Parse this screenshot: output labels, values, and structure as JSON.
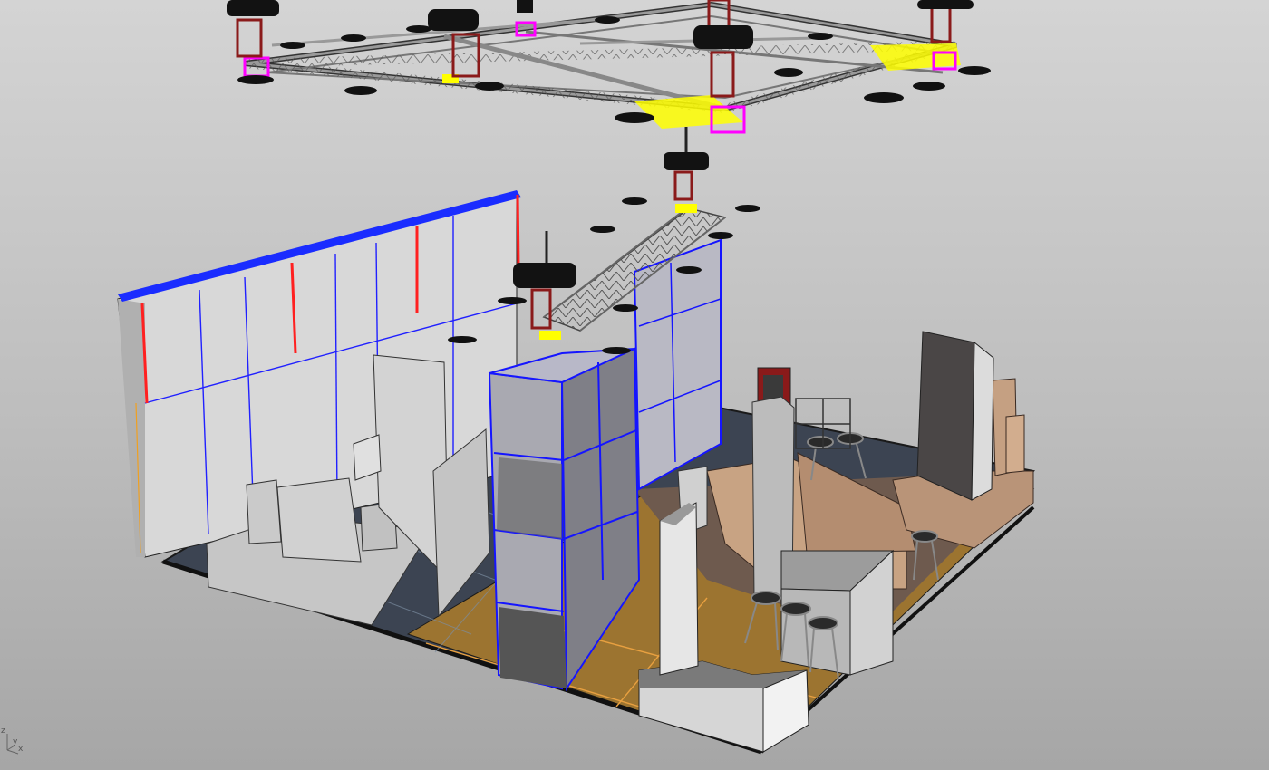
{
  "viewport": {
    "view": "perspective",
    "display_mode": "shaded",
    "background_top": "#d4d4d4",
    "background_bottom": "#a6a6a6"
  },
  "axes": {
    "x_label": "x",
    "y_label": "y",
    "z_label": "z"
  },
  "colors": {
    "selected_truss": "#ffff00",
    "truss_corner": "#ff00ff",
    "wall_edge": "#0000ff",
    "wall_edge_red": "#ff0000",
    "wood": "#c8a383",
    "floor_dark": "#3c4452",
    "floor_orange": "#9c7430"
  },
  "scene_objects": [
    "upper-truss-grid",
    "chain-hoist",
    "moving-head-light",
    "back-wall",
    "glass-tower-column",
    "wood-counter",
    "bar-stool",
    "red-monitor",
    "reception-desk"
  ]
}
